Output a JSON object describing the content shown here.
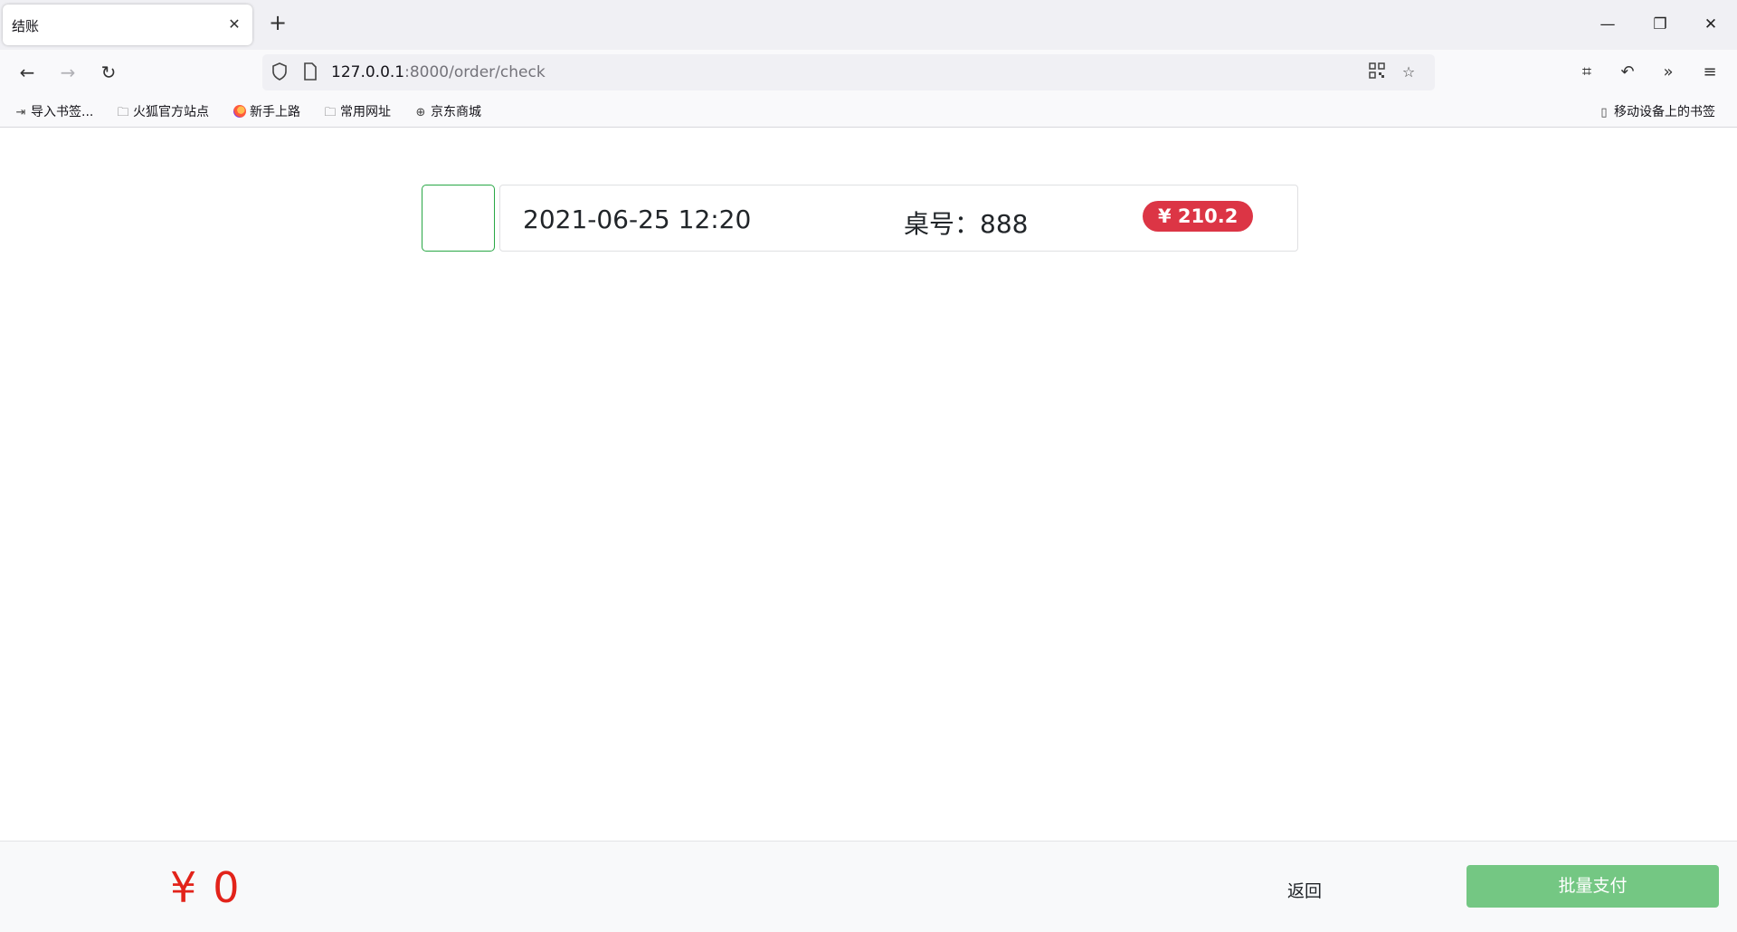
{
  "browser": {
    "tab_title": "结账",
    "tab_close": "✕",
    "new_tab": "+",
    "url_host": "127.0.0.1",
    "url_path": ":8000/order/check",
    "bookmarks": [
      {
        "label": "导入书签...",
        "icon": "import-icon"
      },
      {
        "label": "火狐官方站点",
        "icon": "folder-icon"
      },
      {
        "label": "新手上路",
        "icon": "firefox-icon"
      },
      {
        "label": "常用网址",
        "icon": "folder-icon"
      },
      {
        "label": "京东商城",
        "icon": "globe-icon"
      }
    ],
    "mobile_bookmarks": "移动设备上的书签"
  },
  "orders": [
    {
      "time": "2021-06-25 12:20",
      "table": "桌号：888",
      "amount": "¥ 210.2"
    }
  ],
  "footer": {
    "currency": "¥",
    "total": "0",
    "back_label": "返回",
    "pay_label": "批量支付"
  },
  "colors": {
    "checkbox_border": "#28a745",
    "amount_badge": "#dc3545",
    "total_text": "#e2231a",
    "pay_button": "#74c783"
  }
}
